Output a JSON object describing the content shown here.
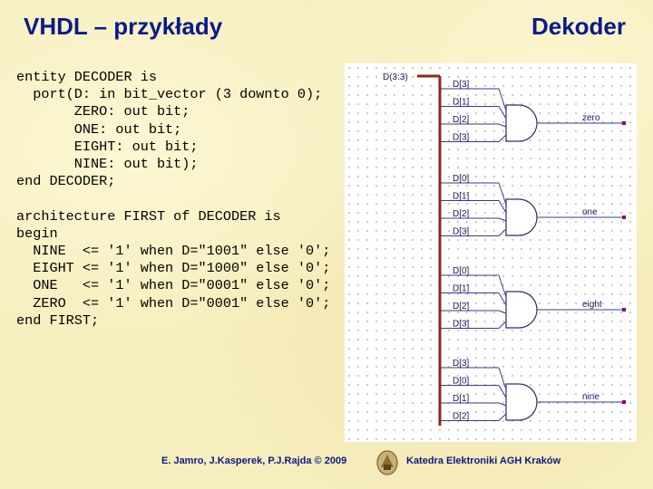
{
  "header": {
    "title": "VHDL – przykłady",
    "subtitle": "Dekoder"
  },
  "code": {
    "lines": [
      [
        "entity DECODER is"
      ],
      [
        "  port(D: in bit_vector (3 downto 0);"
      ],
      [
        "       ZERO: out bit;"
      ],
      [
        "       ONE: out bit;"
      ],
      [
        "       EIGHT: out bit;"
      ],
      [
        "       NINE: out bit);"
      ],
      [
        "end DECODER;"
      ],
      [
        ""
      ],
      [
        "architecture FIRST of DECODER is"
      ],
      [
        "begin"
      ],
      [
        "  NINE  <= '1' when D=\"1001\" else '0';"
      ],
      [
        "  EIGHT <= '1' when D=\"1000\" else '0';"
      ],
      [
        "  ONE   <= '1' when D=\"0001\" else '0';"
      ],
      [
        "  ZERO  <= '1' when D=\"0001\" else '0';"
      ],
      [
        "end FIRST;"
      ]
    ]
  },
  "schematic": {
    "bus_label": "D(3:3)",
    "groups": [
      {
        "inputs": [
          "D[3]",
          "D[1]",
          "D[2]",
          "D[3]"
        ],
        "output": "zero"
      },
      {
        "inputs": [
          "D[0]",
          "D[1]",
          "D[2]",
          "D[3]"
        ],
        "output": "one"
      },
      {
        "inputs": [
          "D[0]",
          "D[1]",
          "D[2]",
          "D[3]"
        ],
        "output": "eight"
      },
      {
        "inputs": [
          "D[3]",
          "D[0]",
          "D[1]",
          "D[2]"
        ],
        "output": "nine"
      }
    ]
  },
  "footer": {
    "authors": "E. Jamro, J.Kasperek, P.J.Rajda © 2009",
    "department": "Katedra Elektroniki AGH Kraków"
  },
  "colors": {
    "title": "#0a1a8a",
    "bus": "#8b2a1a",
    "pin": "#8b008b"
  }
}
